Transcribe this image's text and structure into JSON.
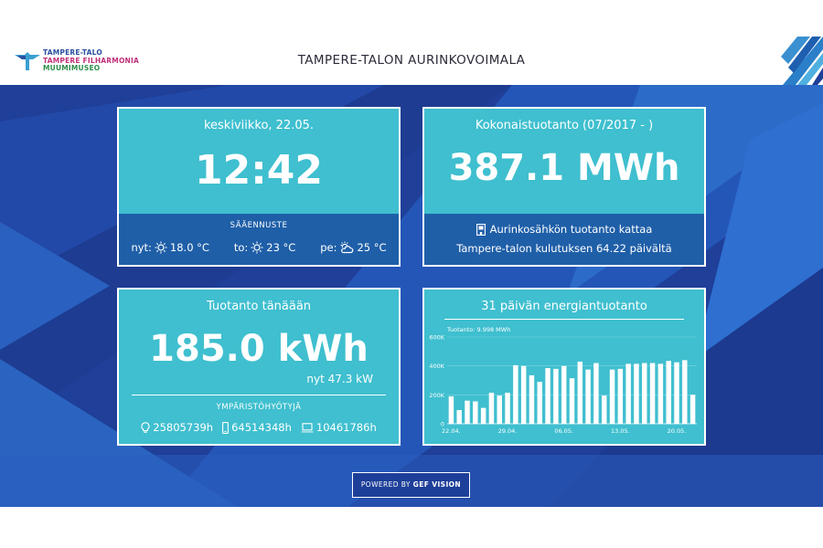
{
  "header": {
    "logo_lines": [
      "TAMPERE-TALO",
      "TAMPERE FILHARMONIA",
      "MUUMIMUSEO"
    ],
    "title": "TAMPERE-TALON AURINKOVOIMALA"
  },
  "clock_card": {
    "date": "keskiviikko, 22.05.",
    "time": "12:42",
    "forecast_label": "SÄÄENNUSTE",
    "forecast": [
      {
        "prefix": "nyt:",
        "icon": "sun-icon",
        "value": "18.0 °C"
      },
      {
        "prefix": "to:",
        "icon": "sun-icon",
        "value": "23 °C"
      },
      {
        "prefix": "pe:",
        "icon": "cloud-sun-icon",
        "value": "25 °C"
      }
    ]
  },
  "total_card": {
    "title": "Kokonaistuotanto (07/2017 - )",
    "value": "387.1 MWh",
    "line1": "Aurinkosähkön tuotanto kattaa",
    "line2": "Tampere-talon kulutuksen 64.22 päivältä",
    "icon": "building-icon"
  },
  "today_card": {
    "title": "Tuotanto tänäään",
    "value": "185.0 kWh",
    "now": "nyt 47.3 kW",
    "eco_label": "YMPÄRISTÖHYÖTYJÄ",
    "eco": [
      {
        "icon": "lightbulb-icon",
        "value": "25805739h"
      },
      {
        "icon": "phone-icon",
        "value": "64514348h"
      },
      {
        "icon": "laptop-icon",
        "value": "10461786h"
      }
    ]
  },
  "chart_card": {
    "title": "31 päivän energiantuotanto"
  },
  "chart_data": {
    "type": "bar",
    "title": "31 päivän energiantuotanto",
    "annotation": "Tuotanto: 9.998 MWh",
    "ylim": [
      0,
      600000
    ],
    "yticks": [
      {
        "v": 0,
        "label": "0"
      },
      {
        "v": 200000,
        "label": "200K"
      },
      {
        "v": 400000,
        "label": "400K"
      },
      {
        "v": 600000,
        "label": "600K"
      }
    ],
    "xtick_labels": [
      {
        "i": 0,
        "label": "22.04."
      },
      {
        "i": 7,
        "label": "29.04."
      },
      {
        "i": 14,
        "label": "06.05."
      },
      {
        "i": 21,
        "label": "13.05."
      },
      {
        "i": 28,
        "label": "20.05."
      }
    ],
    "values": [
      190000,
      95000,
      160000,
      155000,
      110000,
      215000,
      195000,
      215000,
      405000,
      400000,
      335000,
      290000,
      385000,
      380000,
      400000,
      315000,
      430000,
      375000,
      420000,
      195000,
      375000,
      380000,
      415000,
      415000,
      420000,
      420000,
      415000,
      435000,
      425000,
      440000,
      200000
    ]
  },
  "footer": {
    "powered_prefix": "POWERED BY ",
    "powered_brand": "GEF VISION"
  }
}
